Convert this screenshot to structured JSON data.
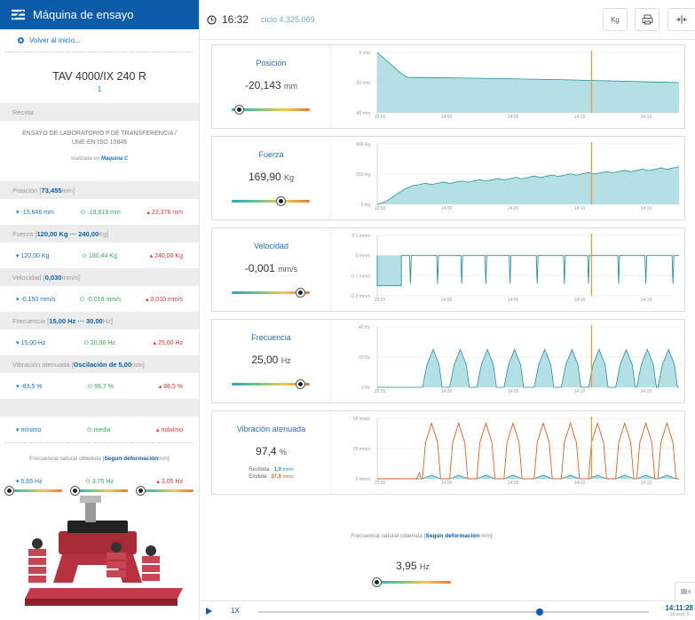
{
  "app": {
    "title": "Máquina de ensayo"
  },
  "sidebar": {
    "back_label": "Volver al inicio...",
    "machine_name": "TAV 4000/IX 240 R",
    "machine_sub": "1",
    "recipe_header": "Receta",
    "recipe_text": "ENSAYO DE LABORATORIO P.DE TRANSFERENCIA / UNE-EN ISO 10846",
    "recipe_done_prefix": "realizada en",
    "recipe_machine": "Máquina C",
    "sections": [
      {
        "label": "Posición [",
        "bold": "73,455",
        "unit": " mm]",
        "min": "-15,846 mm",
        "avg": "-19,819 mm",
        "max": "22,376 mm"
      },
      {
        "label": "Fuerza [",
        "bold": "120,00 Kg ··· 240,00",
        "unit": " Kg]",
        "min": "120,00 Kg",
        "avg": "180,44 Kg",
        "max": "240,00 Kg"
      },
      {
        "label": "Velocidad [",
        "bold": "0,030",
        "unit": " mm/s]",
        "min": "-0,150 mm/s",
        "avg": "-0,016 mm/s",
        "max": "0,010 mm/s"
      },
      {
        "label": "Frecuencia [",
        "bold": "15,00 Hz ··· 30,00",
        "unit": " Hz]",
        "min": "15,00 Hz",
        "avg": "20,96 Hz",
        "max": "25,00 Hz"
      },
      {
        "label": "Vibración atenuada [",
        "bold": "Oscilación de 5,00",
        "unit": " mm]",
        "min": "-83,5 %",
        "avg": "96,7 %",
        "max": "98,5 %"
      }
    ],
    "legend": {
      "min": "mínimo",
      "avg": "media",
      "max": "máximo"
    },
    "natfreq": {
      "label": "Frecuencia natural obtenida [",
      "bold": "Según deformación",
      "unit": " mm]",
      "min": "5,65 Hz",
      "avg": "3,75 Hz",
      "max": "3,05 Hz",
      "slider_levels": [
        0.0,
        0.0,
        0.0
      ]
    }
  },
  "topbar": {
    "time": "16:32",
    "cycle": "ciclo 4.325.069",
    "unit_button": "Kg"
  },
  "x_ticks": [
    "13:55",
    "14:00",
    "14:05",
    "14:10",
    "14:15"
  ],
  "panels": [
    {
      "title": "Posición",
      "value": "-20,143",
      "unit": "mm",
      "level": 0.05
    },
    {
      "title": "Fuerza",
      "value": "169,90",
      "unit": "Kg",
      "level": 0.65
    },
    {
      "title": "Velocidad",
      "value": "-0,001",
      "unit": "mm/s",
      "level": 0.93
    },
    {
      "title": "Frecuencia",
      "value": "25,00",
      "unit": "Hz",
      "level": 0.93
    },
    {
      "title": "Vibración atenuada",
      "value": "97,4",
      "unit": "%",
      "recv_label": "Recibida",
      "recv_val": "1,0",
      "recv_unit": "mm/s",
      "emit_label": "Emitida",
      "emit_val": "37,9",
      "emit_unit": "mm/s"
    }
  ],
  "chart_data": [
    {
      "type": "area",
      "title": "Posición",
      "y_ticks": [
        "0 mm",
        "-20 mm",
        "-40 mm"
      ],
      "ylim": [
        -40,
        0
      ],
      "x": [
        "13:55",
        "14:00",
        "14:05",
        "14:10",
        "14:15"
      ],
      "series": [
        {
          "values": [
            0,
            -17,
            -18,
            -19,
            -20
          ]
        }
      ]
    },
    {
      "type": "area",
      "title": "Fuerza",
      "y_ticks": [
        "400 Kg",
        "200 Kg",
        "0 Kg"
      ],
      "ylim": [
        0,
        400
      ],
      "x": [
        "13:55",
        "14:00",
        "14:05",
        "14:10",
        "14:15"
      ],
      "series": [
        {
          "values": [
            0,
            130,
            150,
            180,
            230
          ]
        }
      ]
    },
    {
      "type": "line",
      "title": "Velocidad",
      "y_ticks": [
        "0.1 mm/s",
        "0 mm/s",
        "-0.1 mm/s",
        "-0.2 mm/s"
      ],
      "ylim": [
        -0.2,
        0.1
      ],
      "x": [
        "13:55",
        "14:00",
        "14:05",
        "14:10",
        "14:15"
      ]
    },
    {
      "type": "area",
      "title": "Frecuencia",
      "y_ticks": [
        "40 Hz",
        "20 Hz",
        "0 Hz"
      ],
      "ylim": [
        0,
        40
      ],
      "x": [
        "13:55",
        "14:00",
        "14:05",
        "14:10",
        "14:15"
      ]
    },
    {
      "type": "line",
      "title": "Vibración atenuada",
      "y_ticks": [
        "50 mm/s",
        "25 mm/s",
        "0 mm/s"
      ],
      "ylim": [
        0,
        50
      ],
      "x": [
        "13:55",
        "14:00",
        "14:05",
        "14:10",
        "14:15"
      ]
    }
  ],
  "natfreq_main": {
    "label": "Frecuencia natural obtenida [",
    "bold": "Según deformación",
    "unit": " mm]",
    "value": "3,95",
    "unit_val": "Hz",
    "level": 0.0
  },
  "player": {
    "speed": "1X",
    "time": "14:11:28",
    "date": "30 sept. 2...",
    "progress": 0.72
  },
  "colors": {
    "brand": "#0a5ca9",
    "area": "#a7dbe0",
    "line": "#2a8fa0",
    "cursor": "#f39a3a",
    "emit": "#d9622b"
  }
}
